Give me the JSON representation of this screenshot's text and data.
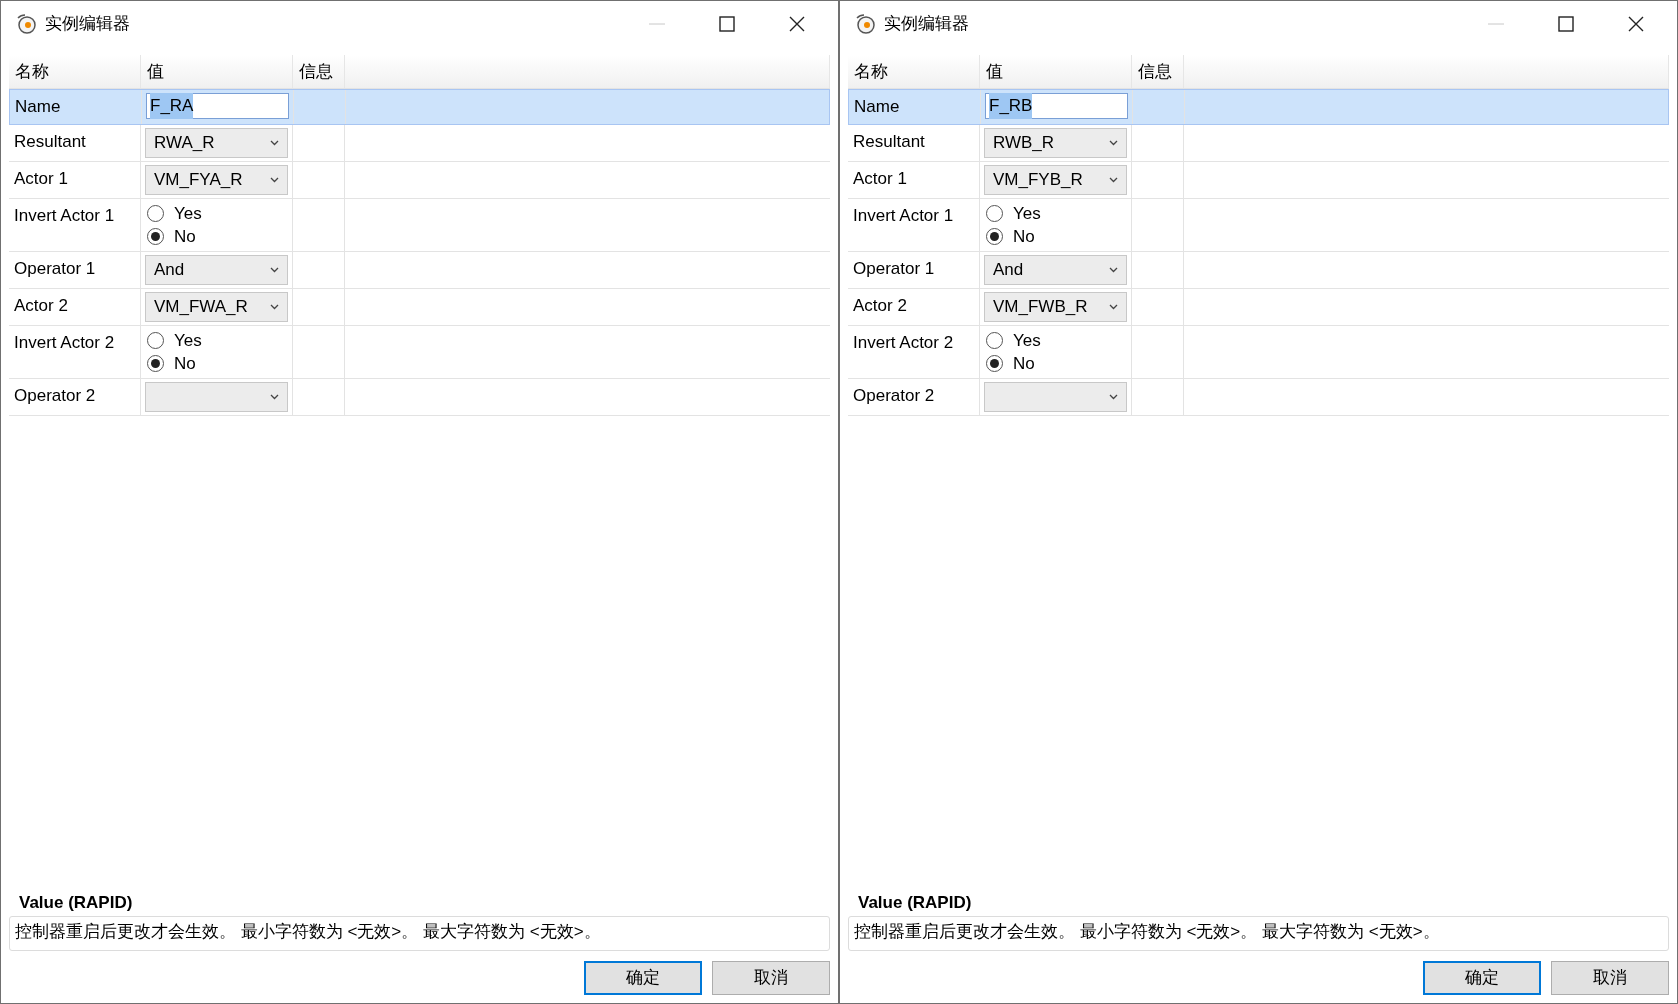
{
  "windows": [
    {
      "title": "实例编辑器",
      "columns": [
        "名称",
        "值",
        "信息"
      ],
      "rows": [
        {
          "kind": "text",
          "label": "Name",
          "value": "F_RA",
          "selected": true
        },
        {
          "kind": "select",
          "label": "Resultant",
          "value": "RWA_R",
          "selected": false
        },
        {
          "kind": "select",
          "label": "Actor 1",
          "value": "VM_FYA_R",
          "selected": false
        },
        {
          "kind": "radio",
          "label": "Invert Actor 1",
          "selected": false,
          "options": [
            {
              "label": "Yes",
              "selected": false
            },
            {
              "label": "No",
              "selected": true
            }
          ]
        },
        {
          "kind": "select",
          "label": "Operator 1",
          "value": "And",
          "selected": false
        },
        {
          "kind": "select",
          "label": "Actor 2",
          "value": "VM_FWA_R",
          "selected": false
        },
        {
          "kind": "radio",
          "label": "Invert Actor 2",
          "selected": false,
          "options": [
            {
              "label": "Yes",
              "selected": false
            },
            {
              "label": "No",
              "selected": true
            }
          ]
        },
        {
          "kind": "select",
          "label": "Operator 2",
          "selected": false
        }
      ],
      "description": {
        "title": "Value (RAPID)",
        "text": "控制器重启后更改才会生效。 最小字符数为 <无效>。 最大字符数为 <无效>。"
      },
      "buttons": [
        {
          "label": "确定",
          "default": true
        },
        {
          "label": "取消",
          "default": false
        }
      ]
    },
    {
      "title": "实例编辑器",
      "columns": [
        "名称",
        "值",
        "信息"
      ],
      "rows": [
        {
          "kind": "text",
          "label": "Name",
          "value": "F_RB",
          "selected": true
        },
        {
          "kind": "select",
          "label": "Resultant",
          "value": "RWB_R",
          "selected": false
        },
        {
          "kind": "select",
          "label": "Actor 1",
          "value": "VM_FYB_R",
          "selected": false
        },
        {
          "kind": "radio",
          "label": "Invert Actor 1",
          "selected": false,
          "options": [
            {
              "label": "Yes",
              "selected": false
            },
            {
              "label": "No",
              "selected": true
            }
          ]
        },
        {
          "kind": "select",
          "label": "Operator 1",
          "value": "And",
          "selected": false
        },
        {
          "kind": "select",
          "label": "Actor 2",
          "value": "VM_FWB_R",
          "selected": false
        },
        {
          "kind": "radio",
          "label": "Invert Actor 2",
          "selected": false,
          "options": [
            {
              "label": "Yes",
              "selected": false
            },
            {
              "label": "No",
              "selected": true
            }
          ]
        },
        {
          "kind": "select",
          "label": "Operator 2",
          "selected": false
        }
      ],
      "description": {
        "title": "Value (RAPID)",
        "text": "控制器重启后更改才会生效。 最小字符数为 <无效>。 最大字符数为 <无效>。"
      },
      "buttons": [
        {
          "label": "确定",
          "default": true
        },
        {
          "label": "取消",
          "default": false
        }
      ]
    }
  ]
}
